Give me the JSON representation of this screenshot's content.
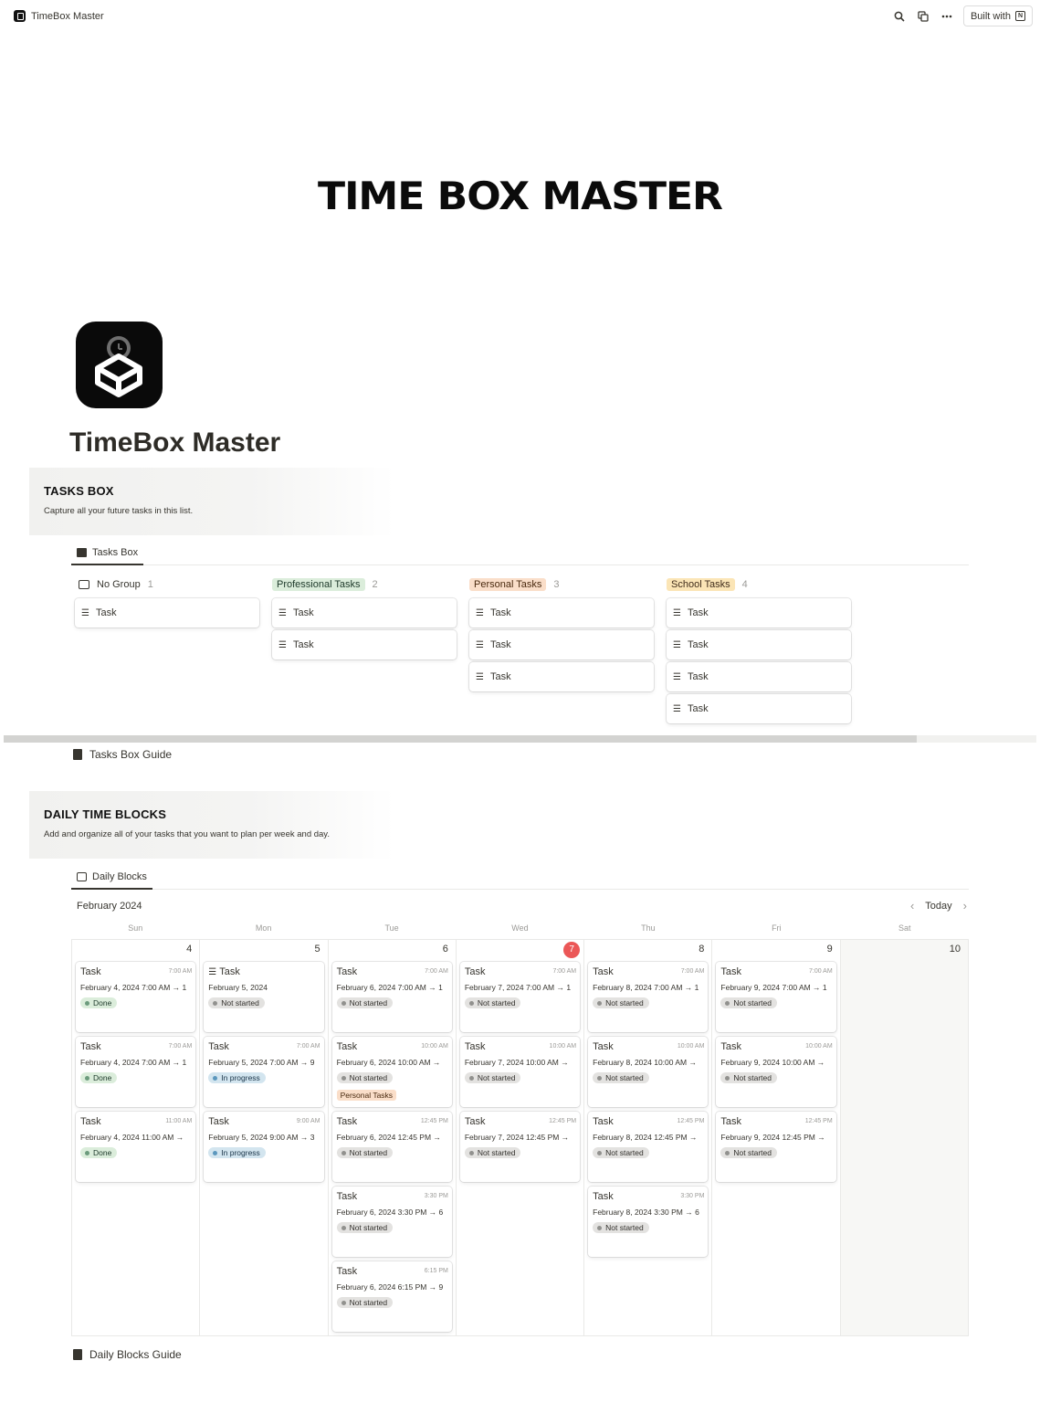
{
  "topbar": {
    "site_title": "TimeBox Master",
    "built_with_label": "Built with",
    "icons": [
      "search-icon",
      "duplicate-icon",
      "more-icon",
      "notion-icon"
    ]
  },
  "banner_text": "TIME BOX MASTER",
  "page_title": "TimeBox Master",
  "tasks_box": {
    "heading": "TASKS BOX",
    "description": "Capture all your future tasks in this list.",
    "view_tab": "Tasks Box",
    "columns": [
      {
        "name": "No Group",
        "count": "1",
        "cards": [
          "Task"
        ]
      },
      {
        "name": "Professional Tasks",
        "count": "2",
        "color": "#dbeddb",
        "cards": [
          "Task",
          "Task"
        ]
      },
      {
        "name": "Personal Tasks",
        "count": "3",
        "color": "#fadec9",
        "cards": [
          "Task",
          "Task",
          "Task"
        ]
      },
      {
        "name": "School Tasks",
        "count": "4",
        "color": "#fbe5b6",
        "cards": [
          "Task",
          "Task",
          "Task",
          "Task"
        ]
      }
    ],
    "guide": "Tasks Box Guide"
  },
  "daily_blocks": {
    "heading": "DAILY TIME BLOCKS",
    "description": "Add and organize all of your tasks that you want to plan per week and day.",
    "view_tab": "Daily Blocks",
    "month": "February 2024",
    "today_label": "Today",
    "weekdays": [
      "Sun",
      "Mon",
      "Tue",
      "Wed",
      "Thu",
      "Fri",
      "Sat"
    ],
    "today_color": "#eb5757",
    "days": [
      {
        "num": "4",
        "events": [
          {
            "title": "Task",
            "time": "7:00 AM",
            "date": "February 4, 2024 7:00 AM → 1",
            "status": "Done",
            "status_type": "done"
          },
          {
            "title": "Task",
            "time": "7:00 AM",
            "date": "February 4, 2024 7:00 AM → 1",
            "status": "Done",
            "status_type": "done"
          },
          {
            "title": "Task",
            "time": "11:00 AM",
            "date": "February 4, 2024 11:00 AM →",
            "status": "Done",
            "status_type": "done"
          }
        ]
      },
      {
        "num": "5",
        "events": [
          {
            "title": "Task",
            "time": "",
            "date": "February 5, 2024",
            "status": "Not started",
            "status_type": "not",
            "checklist": true
          },
          {
            "title": "Task",
            "time": "7:00 AM",
            "date": "February 5, 2024 7:00 AM → 9",
            "status": "In progress",
            "status_type": "prog"
          },
          {
            "title": "Task",
            "time": "9:00 AM",
            "date": "February 5, 2024 9:00 AM → 3",
            "status": "In progress",
            "status_type": "prog"
          }
        ]
      },
      {
        "num": "6",
        "events": [
          {
            "title": "Task",
            "time": "7:00 AM",
            "date": "February 6, 2024 7:00 AM → 1",
            "status": "Not started",
            "status_type": "not"
          },
          {
            "title": "Task",
            "time": "10:00 AM",
            "date": "February 6, 2024 10:00 AM →",
            "status": "Not started",
            "status_type": "not",
            "tag": "Personal Tasks"
          },
          {
            "title": "Task",
            "time": "12:45 PM",
            "date": "February 6, 2024 12:45 PM →",
            "status": "Not started",
            "status_type": "not"
          },
          {
            "title": "Task",
            "time": "3:30 PM",
            "date": "February 6, 2024 3:30 PM → 6",
            "status": "Not started",
            "status_type": "not"
          },
          {
            "title": "Task",
            "time": "6:15 PM",
            "date": "February 6, 2024 6:15 PM → 9",
            "status": "Not started",
            "status_type": "not"
          }
        ]
      },
      {
        "num": "7",
        "today": true,
        "events": [
          {
            "title": "Task",
            "time": "7:00 AM",
            "date": "February 7, 2024 7:00 AM → 1",
            "status": "Not started",
            "status_type": "not"
          },
          {
            "title": "Task",
            "time": "10:00 AM",
            "date": "February 7, 2024 10:00 AM →",
            "status": "Not started",
            "status_type": "not"
          },
          {
            "title": "Task",
            "time": "12:45 PM",
            "date": "February 7, 2024 12:45 PM →",
            "status": "Not started",
            "status_type": "not"
          }
        ]
      },
      {
        "num": "8",
        "events": [
          {
            "title": "Task",
            "time": "7:00 AM",
            "date": "February 8, 2024 7:00 AM → 1",
            "status": "Not started",
            "status_type": "not"
          },
          {
            "title": "Task",
            "time": "10:00 AM",
            "date": "February 8, 2024 10:00 AM →",
            "status": "Not started",
            "status_type": "not"
          },
          {
            "title": "Task",
            "time": "12:45 PM",
            "date": "February 8, 2024 12:45 PM →",
            "status": "Not started",
            "status_type": "not"
          },
          {
            "title": "Task",
            "time": "3:30 PM",
            "date": "February 8, 2024 3:30 PM → 6",
            "status": "Not started",
            "status_type": "not"
          }
        ]
      },
      {
        "num": "9",
        "events": [
          {
            "title": "Task",
            "time": "7:00 AM",
            "date": "February 9, 2024 7:00 AM → 1",
            "status": "Not started",
            "status_type": "not"
          },
          {
            "title": "Task",
            "time": "10:00 AM",
            "date": "February 9, 2024 10:00 AM →",
            "status": "Not started",
            "status_type": "not"
          },
          {
            "title": "Task",
            "time": "12:45 PM",
            "date": "February 9, 2024 12:45 PM →",
            "status": "Not started",
            "status_type": "not"
          }
        ]
      },
      {
        "num": "10",
        "weekend": true,
        "events": []
      }
    ],
    "guide": "Daily Blocks Guide"
  }
}
